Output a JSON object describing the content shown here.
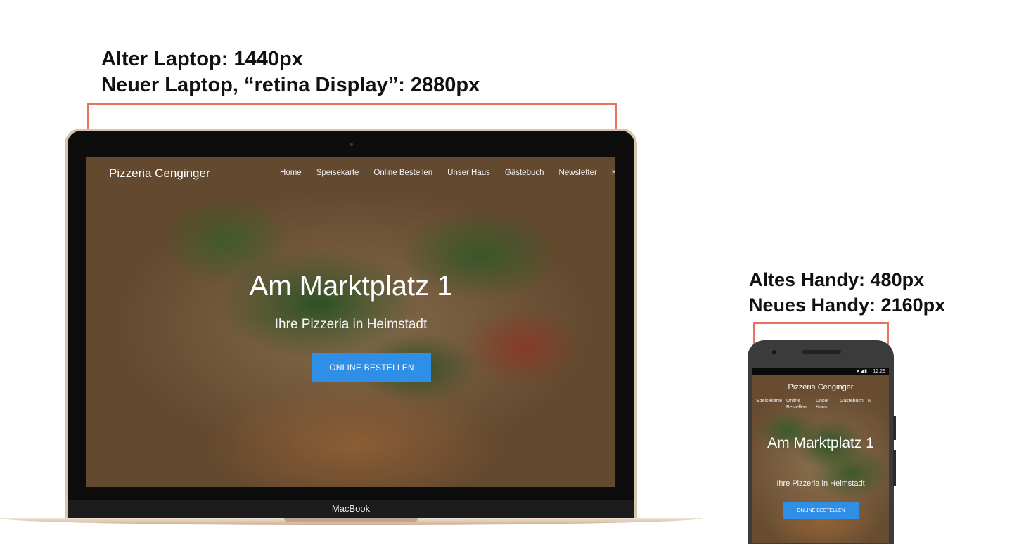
{
  "captions": {
    "laptop_line1": "Alter Laptop: 1440px",
    "laptop_line2": "Neuer Laptop, “retina Display”: 2880px",
    "phone_line1": "Altes Handy: 480px",
    "phone_line2": "Neues Handy:  2160px"
  },
  "laptop": {
    "brand": "MacBook",
    "site": {
      "logo": "Pizzeria Cenginger",
      "nav": [
        "Home",
        "Speisekarte",
        "Online Bestellen",
        "Unser Haus",
        "Gästebuch",
        "Newsletter",
        "Ko"
      ],
      "hero_title": "Am Marktplatz 1",
      "hero_subtitle": "Ihre Pizzeria in Heimstadt",
      "cta": "ONLINE BESTELLEN"
    }
  },
  "phone": {
    "status_time": "12:29",
    "site": {
      "logo": "Pizzeria Cenginger",
      "nav": [
        "Speisekarte",
        "Online Bestellen",
        "Unser Haus",
        "Gästebuch",
        "N"
      ],
      "hero_title": "Am Marktplatz 1",
      "hero_subtitle": "Ihre Pizzeria in Heimstadt",
      "cta": "ONLINE BESTELLEN"
    }
  },
  "colors": {
    "accent_button": "#2f8fe6",
    "bracket": "#e8735b"
  }
}
